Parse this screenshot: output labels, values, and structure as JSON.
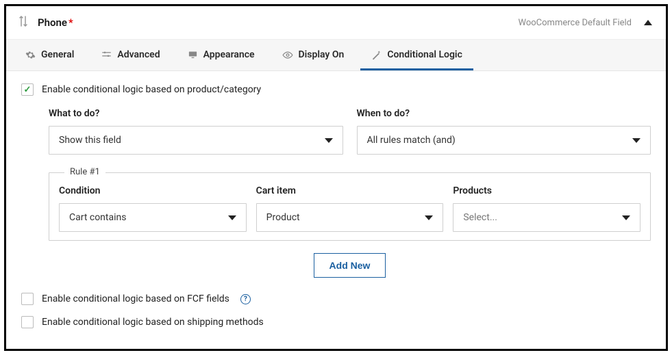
{
  "header": {
    "title": "Phone",
    "required_mark": "*",
    "badge": "WooCommerce Default Field"
  },
  "tabs": {
    "general": "General",
    "advanced": "Advanced",
    "appearance": "Appearance",
    "display_on": "Display On",
    "conditional_logic": "Conditional Logic"
  },
  "enable_product": {
    "label": "Enable conditional logic based on product/category",
    "checked": true
  },
  "what_to_do": {
    "label": "What to do?",
    "value": "Show this field"
  },
  "when_to_do": {
    "label": "When to do?",
    "value": "All rules match (and)"
  },
  "rule": {
    "legend": "Rule #1",
    "condition": {
      "label": "Condition",
      "value": "Cart contains"
    },
    "cart_item": {
      "label": "Cart item",
      "value": "Product"
    },
    "products": {
      "label": "Products",
      "placeholder": "Select..."
    }
  },
  "add_new_label": "Add New",
  "enable_fcf": {
    "label": "Enable conditional logic based on FCF fields"
  },
  "enable_shipping": {
    "label": "Enable conditional logic based on shipping methods"
  }
}
